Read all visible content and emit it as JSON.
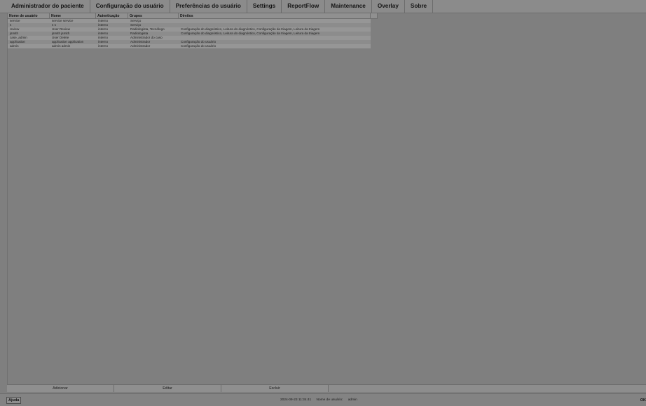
{
  "menu": {
    "items": [
      "Administrador do paciente",
      "Configuração do usuário",
      "Preferências do usuário",
      "Settings",
      "ReportFlow",
      "Maintenance",
      "Overlay",
      "Sobre"
    ]
  },
  "table": {
    "headers": [
      "Nome de usuário",
      "Nome",
      "Autenticação",
      "Grupos",
      "Direitos"
    ],
    "rows": [
      [
        "service",
        "service service",
        "interno",
        "Serviço",
        ""
      ],
      [
        "s",
        "s s",
        "interno",
        "Serviço",
        ""
      ],
      [
        "review",
        "User Review",
        "interno",
        "Radiologista, Tecnólogo",
        "Configuração do diagnóstico, Leitura do diagnóstico, Configuração da triagem, Leitura da triagem"
      ],
      [
        "jsmith",
        "jsmith jsmith",
        "interno",
        "Radiologista",
        "Configuração do diagnóstico, Leitura do diagnóstico, Configuração da triagem, Leitura da triagem"
      ],
      [
        "case_admin",
        "User Delete",
        "interno",
        "Administrador do caso",
        ""
      ],
      [
        "application",
        "application application",
        "interno",
        "Administrador",
        "Configuração do usuário"
      ],
      [
        "admin",
        "admin admin",
        "interno",
        "Administrador",
        "Configuração do usuário"
      ]
    ]
  },
  "buttons": {
    "add_label": "Adicionar",
    "edit_label": "Editar",
    "delete_label": "Excluir"
  },
  "status": {
    "help_label": "Ajuda",
    "datetime": "2024-09-23  11:34:41",
    "username_label": "Nome de usuário:",
    "username": "admin",
    "right_text": "OK"
  }
}
